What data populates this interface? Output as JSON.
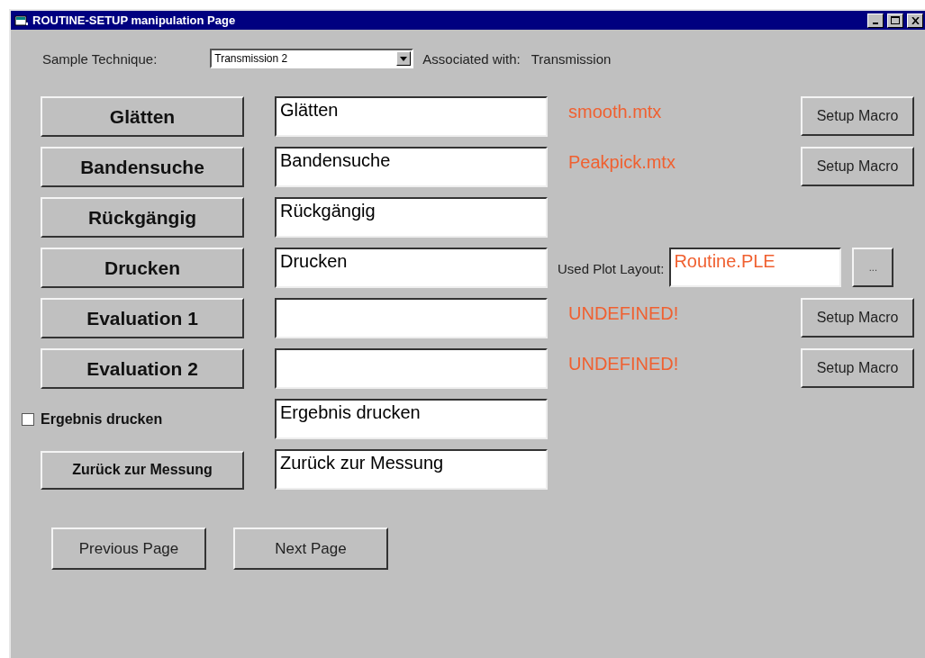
{
  "window": {
    "title": "ROUTINE-SETUP manipulation Page"
  },
  "sample_technique": {
    "label": "Sample Technique:",
    "value": "Transmission 2",
    "associated_label": "Associated with:",
    "associated_value": "Transmission"
  },
  "rows": [
    {
      "kind": "macro",
      "button": "Glätten",
      "value": "Glätten",
      "file": "smooth.mtx",
      "setup": "Setup Macro"
    },
    {
      "kind": "macro",
      "button": "Bandensuche",
      "value": "Bandensuche",
      "file": "Peakpick.mtx",
      "setup": "Setup Macro"
    },
    {
      "kind": "plain",
      "button": "Rückgängig",
      "value": "Rückgängig"
    },
    {
      "kind": "layout",
      "button": "Drucken",
      "value": "Drucken",
      "layout_label": "Used Plot Layout:",
      "layout_value": "Routine.PLE",
      "browse": "..."
    },
    {
      "kind": "macro",
      "button": "Evaluation 1",
      "value": "",
      "file": "UNDEFINED!",
      "setup": "Setup Macro"
    },
    {
      "kind": "macro",
      "button": "Evaluation 2",
      "value": "",
      "file": "UNDEFINED!",
      "setup": "Setup Macro"
    },
    {
      "kind": "checkbox",
      "label": "Ergebnis drucken",
      "checked": false,
      "value": "Ergebnis drucken"
    },
    {
      "kind": "small",
      "button": "Zurück zur Messung",
      "value": "Zurück zur Messung"
    }
  ],
  "nav": [
    "Previous Page",
    "Next Page"
  ]
}
